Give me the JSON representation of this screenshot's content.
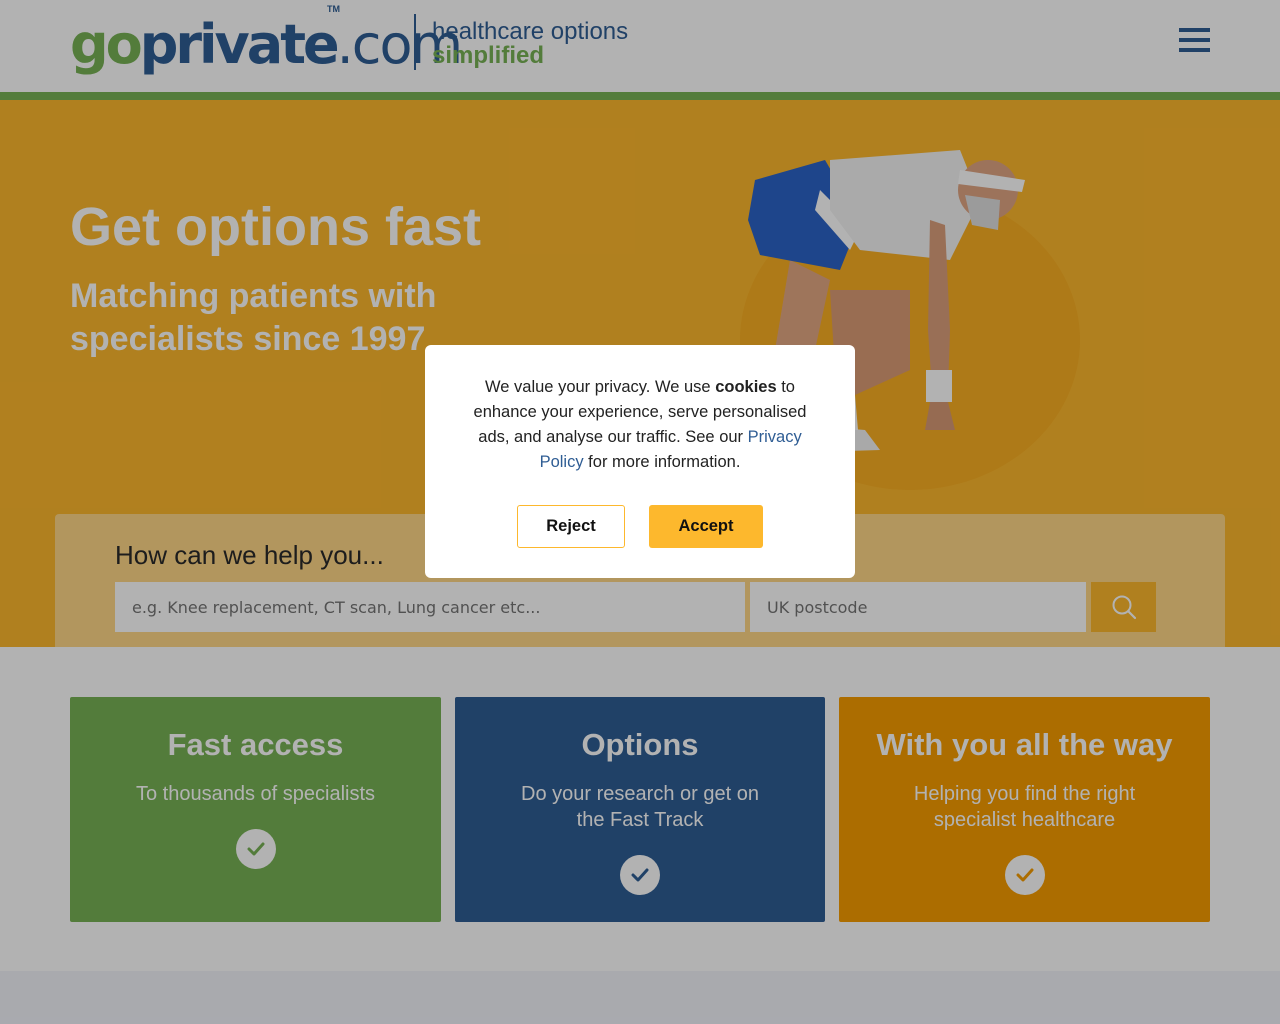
{
  "header": {
    "logo": {
      "go": "go",
      "private": "private",
      "com": ".com",
      "tm": "TM"
    },
    "tagline_line1": "healthcare options",
    "tagline_line2": "simplified",
    "menu_icon": "hamburger-menu-icon"
  },
  "hero": {
    "title": "Get options fast",
    "subtitle": "Matching patients with specialists since 1997",
    "image_icon": "athlete-starting-position-image"
  },
  "search": {
    "heading": "How can we help you...",
    "query_placeholder": "e.g. Knee replacement, CT scan, Lung cancer etc...",
    "query_value": "",
    "postcode_placeholder": "UK postcode",
    "postcode_value": "",
    "button_icon": "search-icon"
  },
  "features": [
    {
      "title": "Fast access",
      "text": "To thousands of specialists",
      "icon": "check-circle-icon",
      "color": "#77b255"
    },
    {
      "title": "Options",
      "text": "Do your research or get on the Fast Track",
      "icon": "check-circle-icon",
      "color": "#2f5d94"
    },
    {
      "title": "With you all the way",
      "text": "Helping you find the right specialist healthcare",
      "icon": "check-circle-icon",
      "color": "#f69d00"
    }
  ],
  "cookie_modal": {
    "text_before": "We value your privacy. We use ",
    "text_bold": "cookies",
    "text_middle": " to enhance your experience, serve personalised ads, and analyse our traffic. See our ",
    "link_text": "Privacy Policy",
    "text_after": " for more information.",
    "reject_label": "Reject",
    "accept_label": "Accept"
  },
  "colors": {
    "brand_green": "#77b255",
    "brand_blue": "#2f5d94",
    "brand_yellow": "#fdb82d",
    "brand_orange": "#f69d00"
  }
}
